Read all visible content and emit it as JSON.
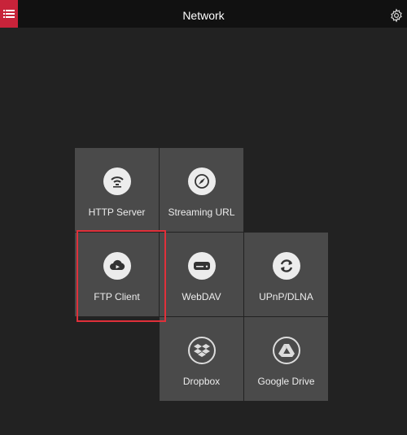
{
  "header": {
    "title": "Network",
    "menu_icon": "hamburger-menu-icon",
    "settings_icon": "gear-icon",
    "menu_color": "#c8233a"
  },
  "tiles": [
    {
      "label": "HTTP Server",
      "icon": "wifi-icon"
    },
    {
      "label": "Streaming URL",
      "icon": "compass-icon"
    },
    {
      "label": "FTP Client",
      "icon": "cloud-upload-icon"
    },
    {
      "label": "WebDAV",
      "icon": "hard-drive-icon"
    },
    {
      "label": "UPnP/DLNA",
      "icon": "sync-icon"
    },
    {
      "label": "Dropbox",
      "icon": "dropbox-icon"
    },
    {
      "label": "Google Drive",
      "icon": "google-drive-icon"
    }
  ],
  "highlight": {
    "target": "FTP Client",
    "color": "#e0303a"
  }
}
